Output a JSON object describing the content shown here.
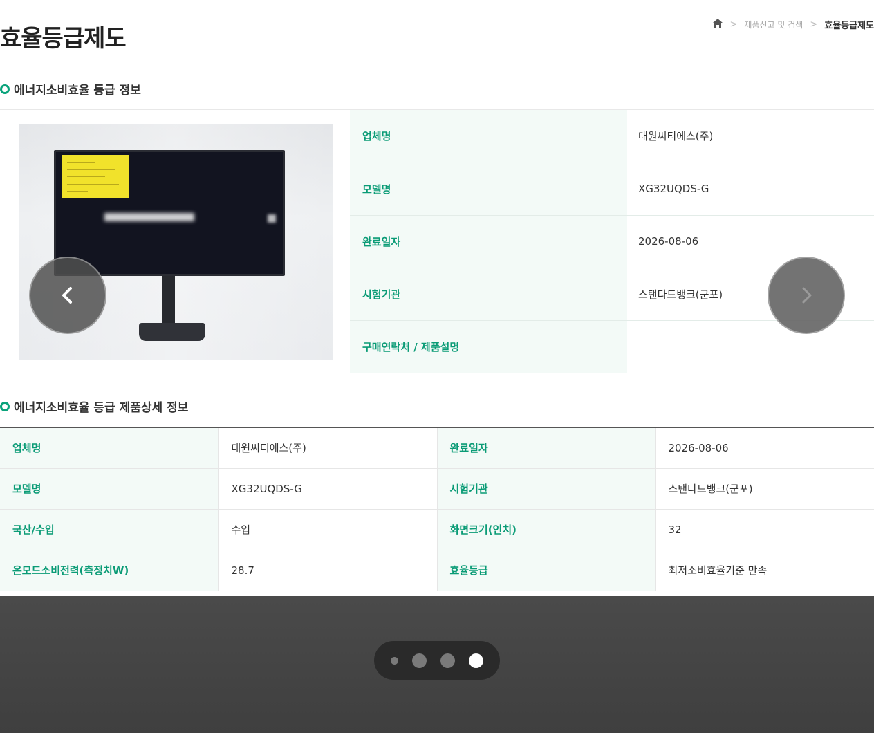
{
  "page": {
    "title": "효율등급제도"
  },
  "breadcrumb": {
    "home_icon": "home-icon",
    "items": [
      "제품신고 및 검색",
      "효율등급제도"
    ]
  },
  "sections": {
    "info": "에너지소비효율 등급 정보",
    "detail": "에너지소비효율 등급 제품상세 정보"
  },
  "info_table": [
    {
      "label": "업체명",
      "value": "대원씨티에스(주)"
    },
    {
      "label": "모델명",
      "value": "XG32UQDS-G"
    },
    {
      "label": "완료일자",
      "value": "2026-08-06"
    },
    {
      "label": "시험기관",
      "value": "스탠다드뱅크(군포)"
    },
    {
      "label": "구매연락처 / 제품설명",
      "value": ""
    }
  ],
  "detail_table": [
    {
      "k1": "업체명",
      "v1": "대원씨티에스(주)",
      "k2": "완료일자",
      "v2": "2026-08-06"
    },
    {
      "k1": "모델명",
      "v1": "XG32UQDS-G",
      "k2": "시험기관",
      "v2": "스탠다드뱅크(군포)"
    },
    {
      "k1": "국산/수입",
      "v1": "수입",
      "k2": "화면크기(인치)",
      "v2": "32"
    },
    {
      "k1": "온모드소비전력(측정치W)",
      "v1": "28.7",
      "k2": "효율등급",
      "v2": "최저소비효율기준 만족"
    }
  ],
  "carousel": {
    "prev_icon": "chevron-left-icon",
    "next_icon": "chevron-right-icon",
    "page_count": 4,
    "active_index": 3
  },
  "colors": {
    "accent": "#0a9b76",
    "label_bg": "#f3faf7",
    "overlay": "#444444"
  }
}
